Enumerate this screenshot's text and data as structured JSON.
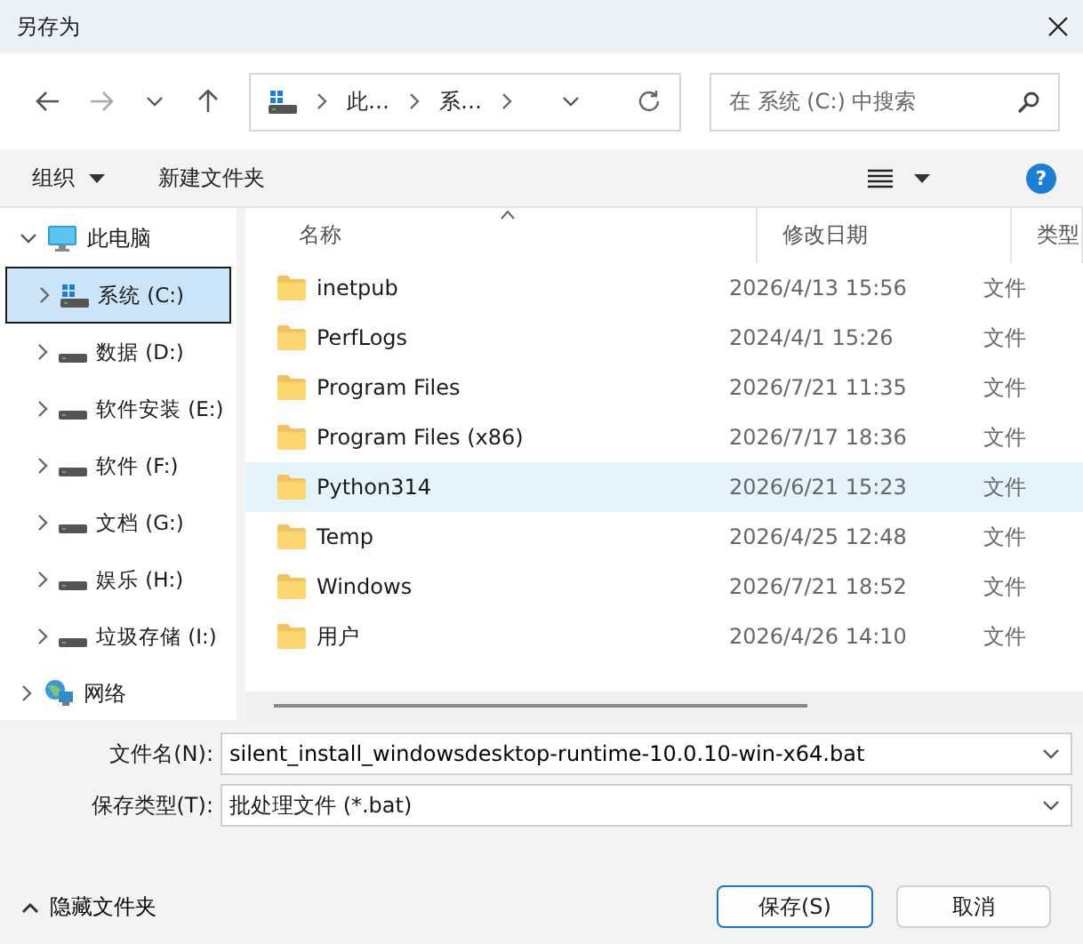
{
  "window": {
    "title": "另存为"
  },
  "nav": {
    "path": [
      "此…",
      "系…"
    ],
    "search": {
      "placeholder": "在 系统 (C:) 中搜索"
    }
  },
  "toolbar": {
    "organize": "组织",
    "new_folder": "新建文件夹",
    "help": "?"
  },
  "tree": [
    {
      "label": "此电脑",
      "kind": "computer",
      "expanded": true,
      "selected": false,
      "children": [
        {
          "label": "系统 (C:)",
          "kind": "system-drive",
          "selected": true
        },
        {
          "label": "数据 (D:)",
          "kind": "drive",
          "selected": false
        },
        {
          "label": "软件安装 (E:)",
          "kind": "drive",
          "selected": false
        },
        {
          "label": "软件 (F:)",
          "kind": "drive",
          "selected": false
        },
        {
          "label": "文档 (G:)",
          "kind": "drive",
          "selected": false
        },
        {
          "label": "娱乐 (H:)",
          "kind": "drive",
          "selected": false
        },
        {
          "label": "垃圾存储 (I:)",
          "kind": "drive",
          "selected": false
        }
      ]
    },
    {
      "label": "网络",
      "kind": "network",
      "expanded": false,
      "selected": false
    }
  ],
  "columns": [
    "名称",
    "修改日期",
    "类型"
  ],
  "files": [
    {
      "name": "inetpub",
      "date": "2026/4/13 15:56",
      "type": "文件",
      "selected": false
    },
    {
      "name": "PerfLogs",
      "date": "2024/4/1 15:26",
      "type": "文件",
      "selected": false
    },
    {
      "name": "Program Files",
      "date": "2026/7/21 11:35",
      "type": "文件",
      "selected": false
    },
    {
      "name": "Program Files (x86)",
      "date": "2026/7/17 18:36",
      "type": "文件",
      "selected": false
    },
    {
      "name": "Python314",
      "date": "2026/6/21 15:23",
      "type": "文件",
      "selected": true
    },
    {
      "name": "Temp",
      "date": "2026/4/25 12:48",
      "type": "文件",
      "selected": false
    },
    {
      "name": "Windows",
      "date": "2026/7/21 18:52",
      "type": "文件",
      "selected": false
    },
    {
      "name": "用户",
      "date": "2026/4/26 14:10",
      "type": "文件",
      "selected": false
    }
  ],
  "filename": {
    "label": "文件名(N):",
    "value": "silent_install_windowsdesktop-runtime-10.0.10-win-x64.bat"
  },
  "filetype": {
    "label": "保存类型(T):",
    "value": "批处理文件 (*.bat)"
  },
  "hide_folders": "隐藏文件夹",
  "buttons": [
    {
      "label": "保存(S)",
      "kind": "primary"
    },
    {
      "label": "取消",
      "kind": "secondary"
    }
  ]
}
